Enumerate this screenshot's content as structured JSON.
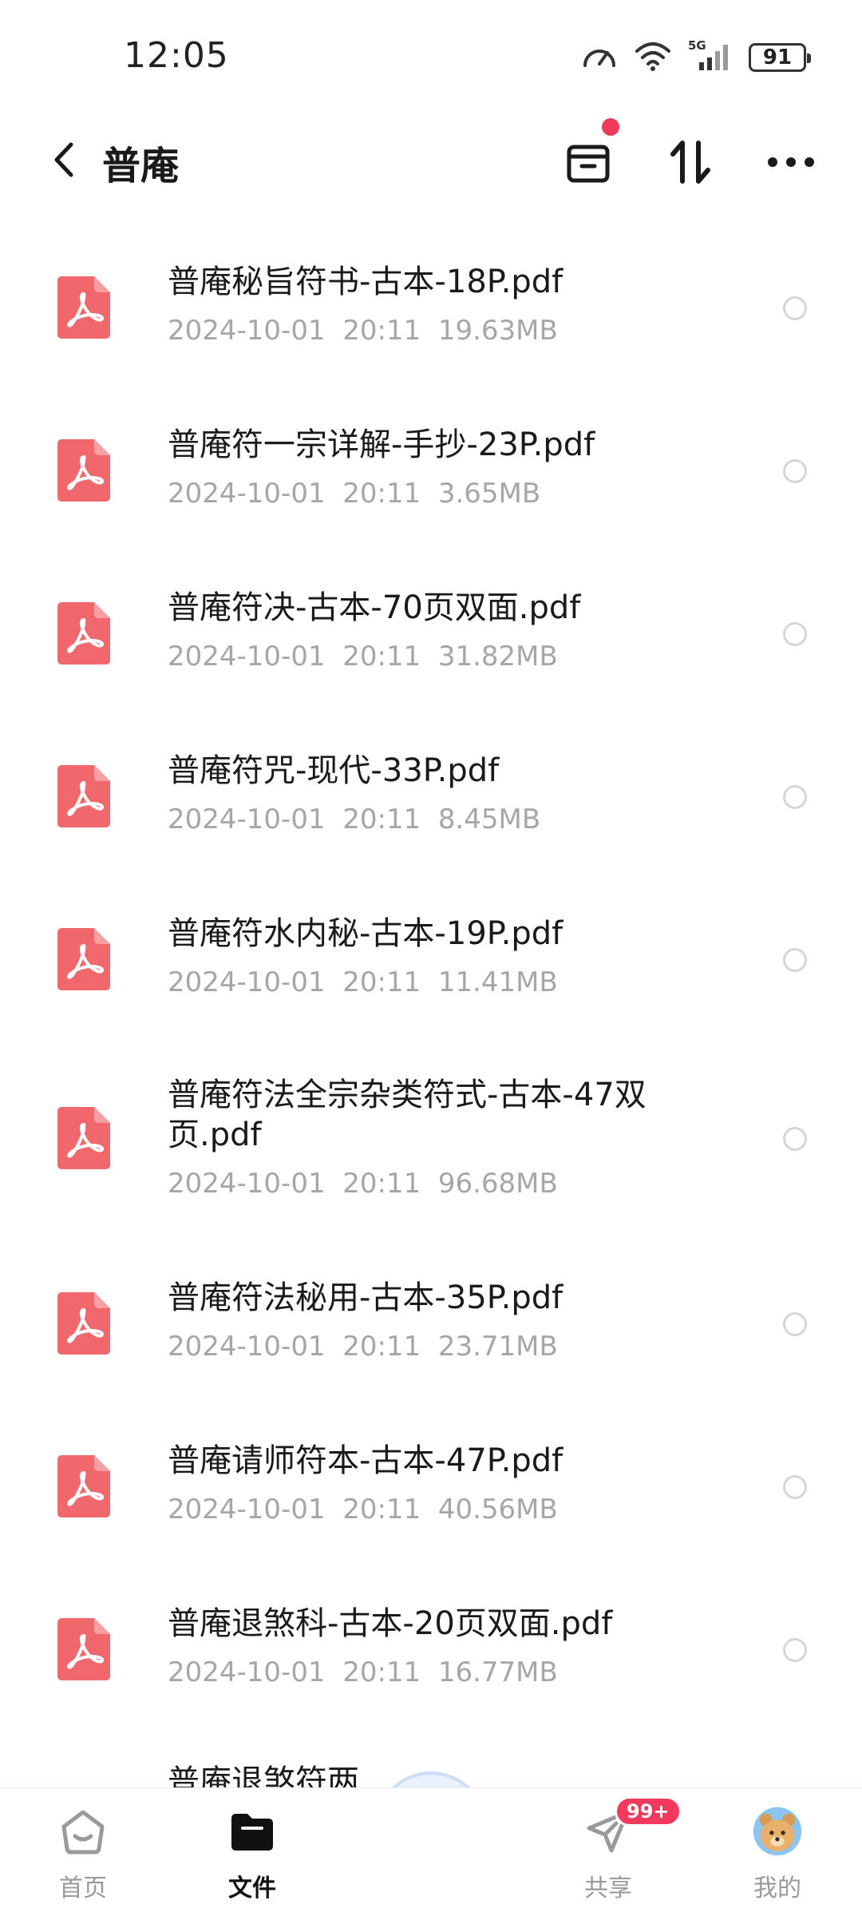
{
  "status_bar": {
    "time": "12:05",
    "battery": "91",
    "network": "5G"
  },
  "header": {
    "title": "普庵",
    "has_notification": true
  },
  "files": [
    {
      "name": "普庵秘旨符书-古本-18P.pdf",
      "date": "2024-10-01",
      "time": "20:11",
      "size": "19.63MB"
    },
    {
      "name": "普庵符一宗详解-手抄-23P.pdf",
      "date": "2024-10-01",
      "time": "20:11",
      "size": "3.65MB"
    },
    {
      "name": "普庵符决-古本-70页双面.pdf",
      "date": "2024-10-01",
      "time": "20:11",
      "size": "31.82MB"
    },
    {
      "name": "普庵符咒-现代-33P.pdf",
      "date": "2024-10-01",
      "time": "20:11",
      "size": "8.45MB"
    },
    {
      "name": "普庵符水内秘-古本-19P.pdf",
      "date": "2024-10-01",
      "time": "20:11",
      "size": "11.41MB"
    },
    {
      "name": "普庵符法全宗杂类符式-古本-47双页.pdf",
      "date": "2024-10-01",
      "time": "20:11",
      "size": "96.68MB"
    },
    {
      "name": "普庵符法秘用-古本-35P.pdf",
      "date": "2024-10-01",
      "time": "20:11",
      "size": "23.71MB"
    },
    {
      "name": "普庵请师符本-古本-47P.pdf",
      "date": "2024-10-01",
      "time": "20:11",
      "size": "40.56MB"
    },
    {
      "name": "普庵退煞科-古本-20页双面.pdf",
      "date": "2024-10-01",
      "time": "20:11",
      "size": "16.77MB"
    },
    {
      "name": "普庵退煞符两",
      "date": "",
      "time": "",
      "size": ""
    }
  ],
  "bottom_nav": [
    {
      "label": "首页",
      "icon": "home-icon",
      "active": false
    },
    {
      "label": "文件",
      "icon": "folder-icon",
      "active": true
    },
    {
      "label": "共享",
      "icon": "share-icon",
      "active": false,
      "badge": "99+"
    },
    {
      "label": "我的",
      "icon": "avatar-icon",
      "active": false
    }
  ],
  "colors": {
    "accent": "#f0395c",
    "pdf_icon": "#f0676c",
    "meta_text": "#a6a6a6"
  }
}
